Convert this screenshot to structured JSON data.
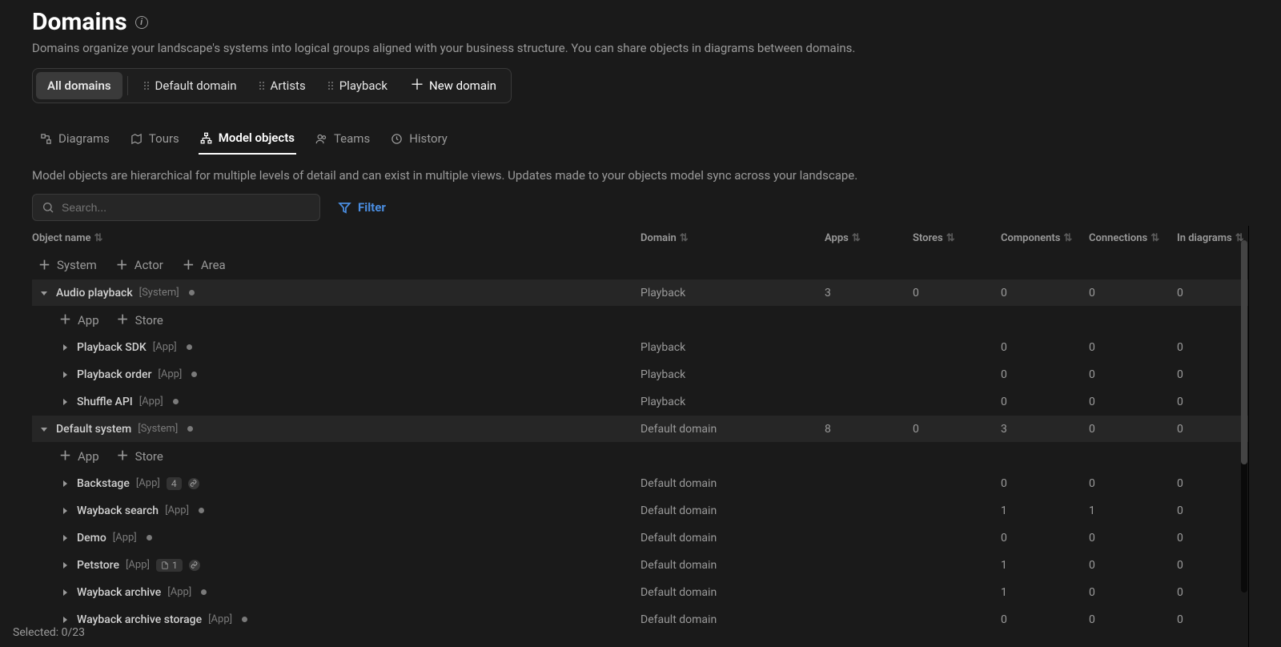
{
  "page": {
    "title": "Domains",
    "subtitle": "Domains organize your landscape's systems into logical groups aligned with your business structure. You can share objects in diagrams between domains."
  },
  "domainBar": {
    "all": "All domains",
    "items": [
      "Default domain",
      "Artists",
      "Playback"
    ],
    "newDomain": "New domain"
  },
  "tabs": {
    "diagrams": "Diagrams",
    "tours": "Tours",
    "modelObjects": "Model objects",
    "teams": "Teams",
    "history": "History"
  },
  "tabDescription": "Model objects are hierarchical for multiple levels of detail and can exist in multiple views. Updates made to your objects model sync across your landscape.",
  "search": {
    "placeholder": "Search..."
  },
  "filterLabel": "Filter",
  "columns": {
    "objectName": "Object name",
    "domain": "Domain",
    "apps": "Apps",
    "stores": "Stores",
    "components": "Components",
    "connections": "Connections",
    "inDiagrams": "In diagrams"
  },
  "addTop": {
    "system": "System",
    "actor": "Actor",
    "area": "Area"
  },
  "addSub": {
    "app": "App",
    "store": "Store"
  },
  "rows": [
    {
      "level": 0,
      "expanded": true,
      "name": "Audio playback",
      "type": "[System]",
      "dot": true,
      "domain": "Playback",
      "apps": "3",
      "stores": "0",
      "components": "0",
      "connections": "0",
      "inDiagrams": "0"
    },
    {
      "addsub": true
    },
    {
      "level": 1,
      "name": "Playback SDK",
      "type": "[App]",
      "dot": true,
      "domain": "Playback",
      "components": "0",
      "connections": "0",
      "inDiagrams": "0"
    },
    {
      "level": 1,
      "name": "Playback order",
      "type": "[App]",
      "dot": true,
      "domain": "Playback",
      "components": "0",
      "connections": "0",
      "inDiagrams": "0"
    },
    {
      "level": 1,
      "name": "Shuffle API",
      "type": "[App]",
      "dot": true,
      "domain": "Playback",
      "components": "0",
      "connections": "0",
      "inDiagrams": "0"
    },
    {
      "level": 0,
      "expanded": true,
      "name": "Default system",
      "type": "[System]",
      "dot": true,
      "domain": "Default domain",
      "apps": "8",
      "stores": "0",
      "components": "3",
      "connections": "0",
      "inDiagrams": "0"
    },
    {
      "addsub": true
    },
    {
      "level": 1,
      "name": "Backstage",
      "type": "[App]",
      "badge": "4",
      "link": true,
      "domain": "Default domain",
      "components": "0",
      "connections": "0",
      "inDiagrams": "0"
    },
    {
      "level": 1,
      "name": "Wayback search",
      "type": "[App]",
      "dot": true,
      "domain": "Default domain",
      "components": "1",
      "connections": "1",
      "inDiagrams": "0"
    },
    {
      "level": 1,
      "name": "Demo",
      "type": "[App]",
      "dot": true,
      "domain": "Default domain",
      "components": "0",
      "connections": "0",
      "inDiagrams": "0"
    },
    {
      "level": 1,
      "name": "Petstore",
      "type": "[App]",
      "docBadge": "1",
      "link": true,
      "domain": "Default domain",
      "components": "1",
      "connections": "0",
      "inDiagrams": "0"
    },
    {
      "level": 1,
      "name": "Wayback archive",
      "type": "[App]",
      "dot": true,
      "domain": "Default domain",
      "components": "1",
      "connections": "0",
      "inDiagrams": "0"
    },
    {
      "level": 1,
      "name": "Wayback archive storage",
      "type": "[App]",
      "dot": true,
      "domain": "Default domain",
      "components": "0",
      "connections": "0",
      "inDiagrams": "0"
    }
  ],
  "footer": {
    "selected": "Selected: 0/23"
  }
}
